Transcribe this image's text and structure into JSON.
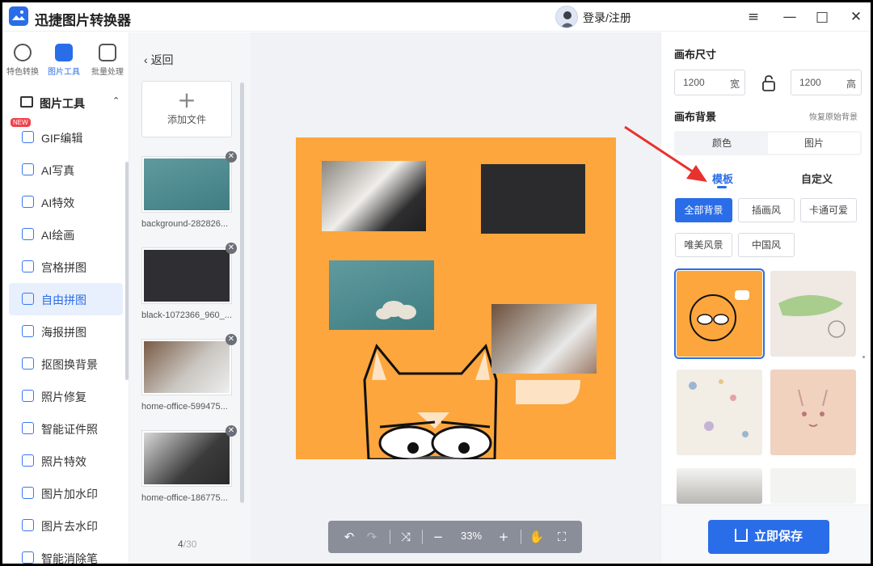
{
  "app": {
    "title": "迅捷图片转换器",
    "login": "登录/注册"
  },
  "window_controls": [
    "≡",
    "—",
    "□",
    "✕"
  ],
  "nav": {
    "tabs": [
      {
        "label": "特色转换",
        "icon": "convert-icon"
      },
      {
        "label": "图片工具",
        "icon": "image-tool-icon",
        "active": true
      },
      {
        "label": "批量处理",
        "icon": "batch-icon"
      }
    ],
    "section": {
      "label": "图片工具",
      "chevron": "⌃"
    },
    "new_badge": "NEW",
    "items": [
      {
        "label": "GIF编辑",
        "icon": "gif-icon"
      },
      {
        "label": "AI写真",
        "icon": "ai-photo-icon"
      },
      {
        "label": "AI特效",
        "icon": "ai-effect-icon"
      },
      {
        "label": "AI绘画",
        "icon": "ai-paint-icon"
      },
      {
        "label": "宫格拼图",
        "icon": "grid-collage-icon"
      },
      {
        "label": "自由拼图",
        "icon": "free-collage-icon",
        "active": true
      },
      {
        "label": "海报拼图",
        "icon": "poster-collage-icon"
      },
      {
        "label": "抠图换背景",
        "icon": "cutout-icon"
      },
      {
        "label": "照片修复",
        "icon": "repair-icon"
      },
      {
        "label": "智能证件照",
        "icon": "id-photo-icon"
      },
      {
        "label": "照片特效",
        "icon": "photo-effect-icon"
      },
      {
        "label": "图片加水印",
        "icon": "add-watermark-icon"
      },
      {
        "label": "图片去水印",
        "icon": "remove-watermark-icon"
      },
      {
        "label": "智能消除笔",
        "icon": "eraser-icon"
      }
    ]
  },
  "files": {
    "back": "返回",
    "add": "添加文件",
    "items": [
      {
        "name": "background-282826..."
      },
      {
        "name": "black-1072366_960_..."
      },
      {
        "name": "home-office-599475..."
      },
      {
        "name": "home-office-186775..."
      }
    ],
    "count": "4",
    "total": "/30"
  },
  "canvas": {
    "background_color": "#fca63d"
  },
  "toolbar": {
    "undo": "↶",
    "redo": "↷",
    "shuffle": "⤨",
    "zoom_out": "−",
    "zoom": "33%",
    "zoom_in": "+",
    "hand": "✋",
    "fit": "⛶"
  },
  "right": {
    "canvas_size_label": "画布尺寸",
    "width": "1200",
    "width_unit": "宽",
    "height": "1200",
    "height_unit": "高",
    "bg_label": "画布背景",
    "restore": "恢复原始背景",
    "seg": [
      "颜色",
      "图片"
    ],
    "subtabs": [
      "模板",
      "自定义"
    ],
    "chips": [
      "全部背景",
      "插画风",
      "卡通可爱",
      "唯美风景",
      "中国风"
    ],
    "save": "立即保存"
  },
  "colors": {
    "accent": "#2a6de8",
    "canvas_bg": "#fca63d",
    "arrow": "#e8322f"
  }
}
